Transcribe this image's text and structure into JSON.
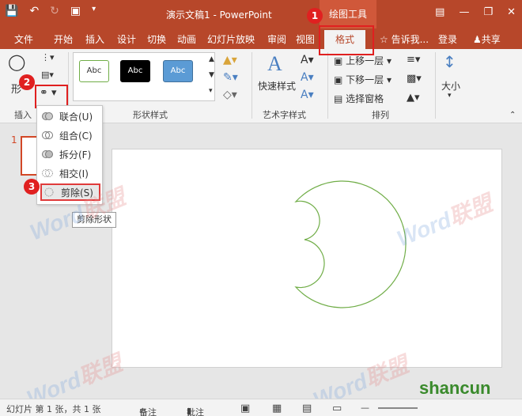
{
  "titlebar": {
    "title": "演示文稿1 - PowerPoint",
    "context_tools": "绘图工具",
    "qat_icons": [
      "save-icon",
      "undo-icon",
      "redo-icon",
      "present-from-start-icon",
      "customize-qat-icon"
    ],
    "window_buttons": [
      "ribbon-display-icon",
      "minimize-icon",
      "restore-icon",
      "close-icon"
    ]
  },
  "tabs": {
    "items": [
      "文件",
      "开始",
      "插入",
      "设计",
      "切换",
      "动画",
      "幻灯片放映",
      "审阅",
      "视图",
      "格式"
    ],
    "active": "格式",
    "tell_me": "告诉我...",
    "login": "登录",
    "share": "共享"
  },
  "ribbon": {
    "insert_shapes": {
      "label_partial": "插入",
      "edit_shape_partial": "形"
    },
    "shape_styles": {
      "label": "形状样式",
      "thumbnails": [
        {
          "text": "Abc",
          "bg": "#ffffff",
          "border": "#70ad47",
          "color": "#333333"
        },
        {
          "text": "Abc",
          "bg": "#000000",
          "border": "#000000",
          "color": "#ffffff"
        },
        {
          "text": "Abc",
          "bg": "#5b9bd5",
          "border": "#41719c",
          "color": "#ffffff"
        }
      ]
    },
    "wordart": {
      "label": "艺术字样式",
      "quick_styles": "快速样式"
    },
    "arrange": {
      "label": "排列",
      "bring_forward": "上移一层",
      "send_backward": "下移一层",
      "selection_pane": "选择窗格"
    },
    "size": {
      "label": "大小"
    }
  },
  "merge_menu": {
    "items": [
      {
        "label": "联合(U)",
        "icon": "union-icon"
      },
      {
        "label": "组合(C)",
        "icon": "combine-icon"
      },
      {
        "label": "拆分(F)",
        "icon": "fragment-icon"
      },
      {
        "label": "相交(I)",
        "icon": "intersect-icon"
      },
      {
        "label": "剪除(S)",
        "icon": "subtract-icon"
      }
    ],
    "highlighted": "剪除(S)",
    "tooltip": "剪除形状"
  },
  "slide_panel": {
    "slide_number": "1"
  },
  "callouts": [
    "1",
    "2",
    "3"
  ],
  "statusbar": {
    "slide_info": "幻灯片 第 1 张，共 1 张",
    "notes": "备注",
    "comments": "批注"
  },
  "watermarks": {
    "word": "Word",
    "lianmeng": "联盟",
    "site": "shancun"
  },
  "colors": {
    "accent": "#b7472a",
    "callout_red": "#e02020",
    "shape_stroke": "#70ad47"
  }
}
